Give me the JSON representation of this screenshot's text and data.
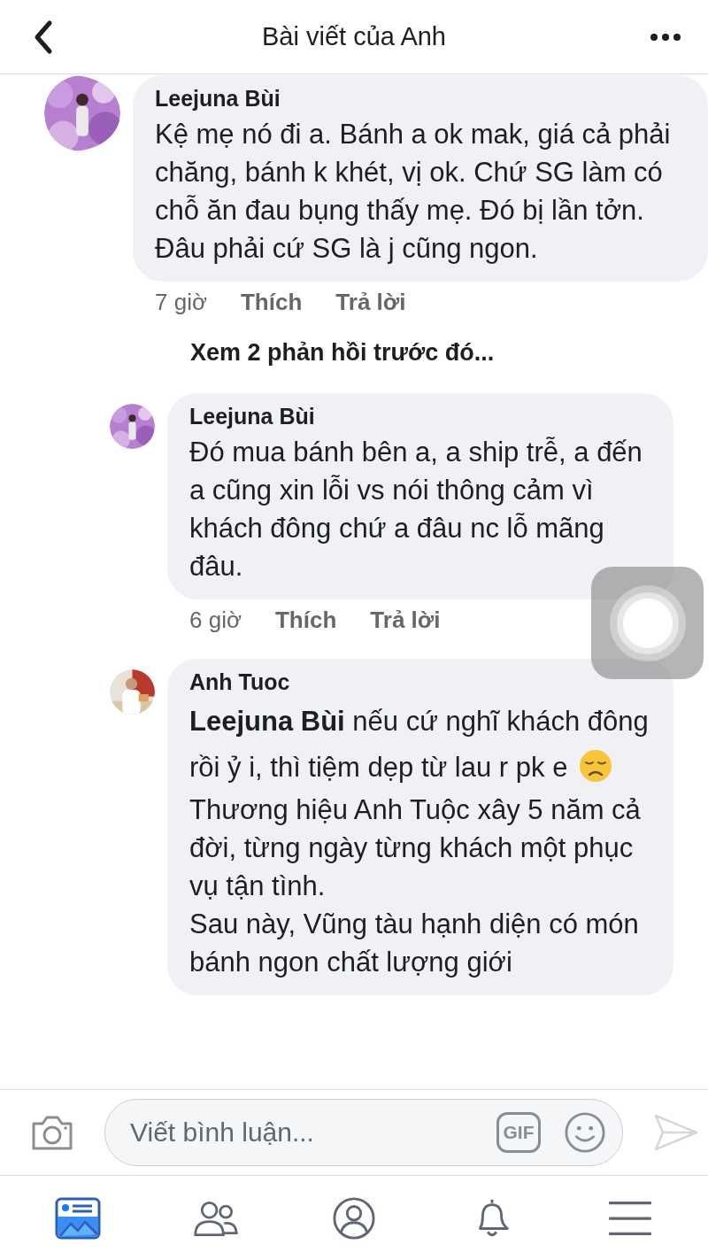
{
  "header": {
    "title": "Bài viết của Anh"
  },
  "comments": [
    {
      "kind": "comment",
      "author": "Leejuna Bùi",
      "paragraphs": [
        {
          "text": "Kệ mẹ nó đi a. Bánh a ok mak, giá cả phải chăng, bánh k khét, vị ok. Chứ SG làm có chỗ ăn đau bụng thấy mẹ. Đó bị lần tởn. Đâu phải cứ SG là j cũng ngon.",
          "emoji": false
        }
      ],
      "time": "7 giờ",
      "like": "Thích",
      "reply": "Trả lời"
    },
    {
      "kind": "link",
      "text": "Xem 2 phản hồi trước đó..."
    },
    {
      "kind": "reply",
      "author": "Leejuna Bùi",
      "paragraphs": [
        {
          "text": "Đó mua bánh bên a, a ship trễ, a đến a cũng xin lỗi vs nói thông cảm vì khách đông chứ a đâu nc lỗ mãng đâu.",
          "emoji": false
        }
      ],
      "time": "6 giờ",
      "like": "Thích",
      "reply": "Trả lời"
    },
    {
      "kind": "reply",
      "author": "Anh Tuoc",
      "paragraphs": [
        {
          "text": "**Leejuna Bùi**  nếu cứ nghĩ khách đông rồi ỷ i, thì tiệm dẹp từ lau r pk e",
          "emoji": true
        },
        {
          "text": "Thương hiệu Anh Tuộc xây 5 năm cả đời, từng ngày từng khách một phục vụ tận tình.",
          "emoji": false
        },
        {
          "text": "Sau này, Vũng tàu hạnh diện có món bánh ngon chất lượng giới",
          "emoji": false
        }
      ]
    }
  ],
  "composer": {
    "placeholder": "Viết bình luận...",
    "gif": "GIF",
    "send_disabled": true
  },
  "tabs": [
    {
      "selected": true
    },
    {
      "selected": false
    },
    {
      "selected": false
    },
    {
      "selected": false
    },
    {
      "selected": false
    }
  ]
}
